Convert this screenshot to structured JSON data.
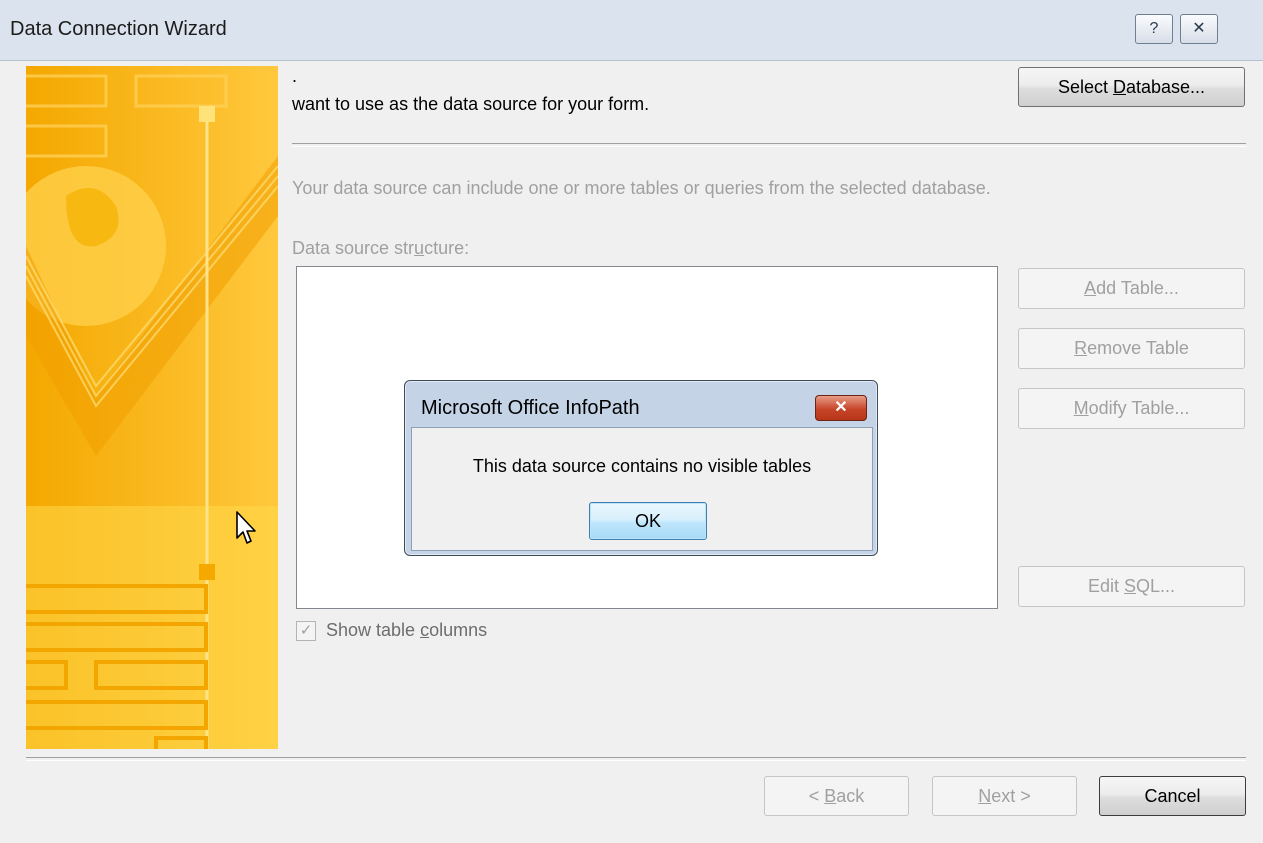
{
  "window": {
    "title": "Data Connection Wizard",
    "help_glyph": "?",
    "close_glyph": "✕"
  },
  "wizard": {
    "top_fragment": ".",
    "intro_text": "want to use as the data source for your form.",
    "select_database_pre": "Select ",
    "select_database_key": "D",
    "select_database_post": "atabase...",
    "description": "Your data source can include one or more tables or queries from the selected database.",
    "structure_label_pre": "Data source str",
    "structure_label_key": "u",
    "structure_label_post": "cture:",
    "add_table_key": "A",
    "add_table_post": "dd Table...",
    "remove_table_key": "R",
    "remove_table_post": "emove Table",
    "modify_table_key": "M",
    "modify_table_post": "odify Table...",
    "edit_sql_pre": "Edit ",
    "edit_sql_key": "S",
    "edit_sql_post": "QL...",
    "show_columns_pre": "Show table ",
    "show_columns_key": "c",
    "show_columns_post": "olumns",
    "show_columns_checked": true,
    "check_glyph": "✓"
  },
  "footer": {
    "back_pre": "< ",
    "back_key": "B",
    "back_post": "ack",
    "next_key": "N",
    "next_post": "ext >",
    "cancel": "Cancel"
  },
  "message_box": {
    "title": "Microsoft Office InfoPath",
    "close_glyph": "✕",
    "message": "This data source contains no visible tables",
    "ok": "OK"
  },
  "colors": {
    "accent_art": "#f7b500",
    "disabled_text": "#a0a0a0",
    "msgbox_frame": "#c4d3e6",
    "close_red": "#c6452a"
  }
}
